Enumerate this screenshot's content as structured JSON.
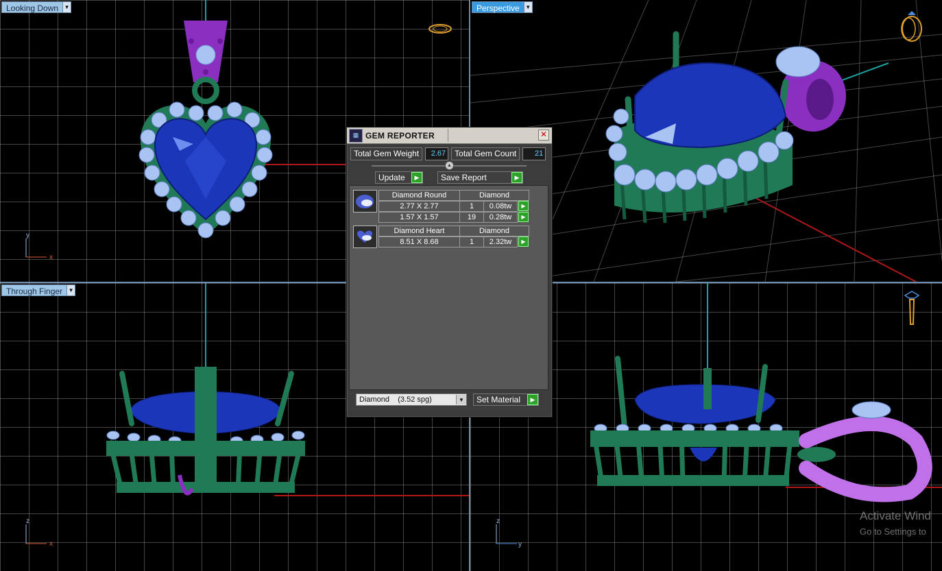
{
  "viewports": {
    "top": {
      "label": "Looking Down"
    },
    "perspective": {
      "label": "Perspective"
    },
    "front": {
      "label": "Through Finger"
    },
    "side": {
      "label": ""
    }
  },
  "axes": {
    "top": {
      "a": "y",
      "b": "x"
    },
    "front": {
      "a": "z",
      "b": "x"
    },
    "side": {
      "a": "z",
      "b": "y"
    }
  },
  "gem_reporter": {
    "title": "GEM REPORTER",
    "total_weight_label": "Total Gem Weight",
    "total_weight_value": "2.67",
    "total_count_label": "Total Gem Count",
    "total_count_value": "21",
    "update_label": "Update",
    "save_report_label": "Save Report",
    "groups": [
      {
        "shape": "Diamond Round",
        "material": "Diamond",
        "rows": [
          {
            "size": "2.77 X 2.77",
            "count": "1",
            "weight": "0.08tw"
          },
          {
            "size": "1.57 X 1.57",
            "count": "19",
            "weight": "0.28tw"
          }
        ]
      },
      {
        "shape": "Diamond Heart",
        "material": "Diamond",
        "rows": [
          {
            "size": "8.51 X 8.68",
            "count": "1",
            "weight": "2.32tw"
          }
        ]
      }
    ],
    "material_select_value": "Diamond    (3.52 spg)",
    "set_material_label": "Set Material"
  },
  "watermark": {
    "line1": "Activate Wind",
    "line2": "Go to Settings to"
  },
  "colors": {
    "metal": "#1f7a55",
    "gem_blue": "#1b36b8",
    "diamond": "#a9c4f2",
    "bail": "#8a2fc0",
    "bail_light": "#c070e8",
    "accent_go": "#2fa02a"
  }
}
